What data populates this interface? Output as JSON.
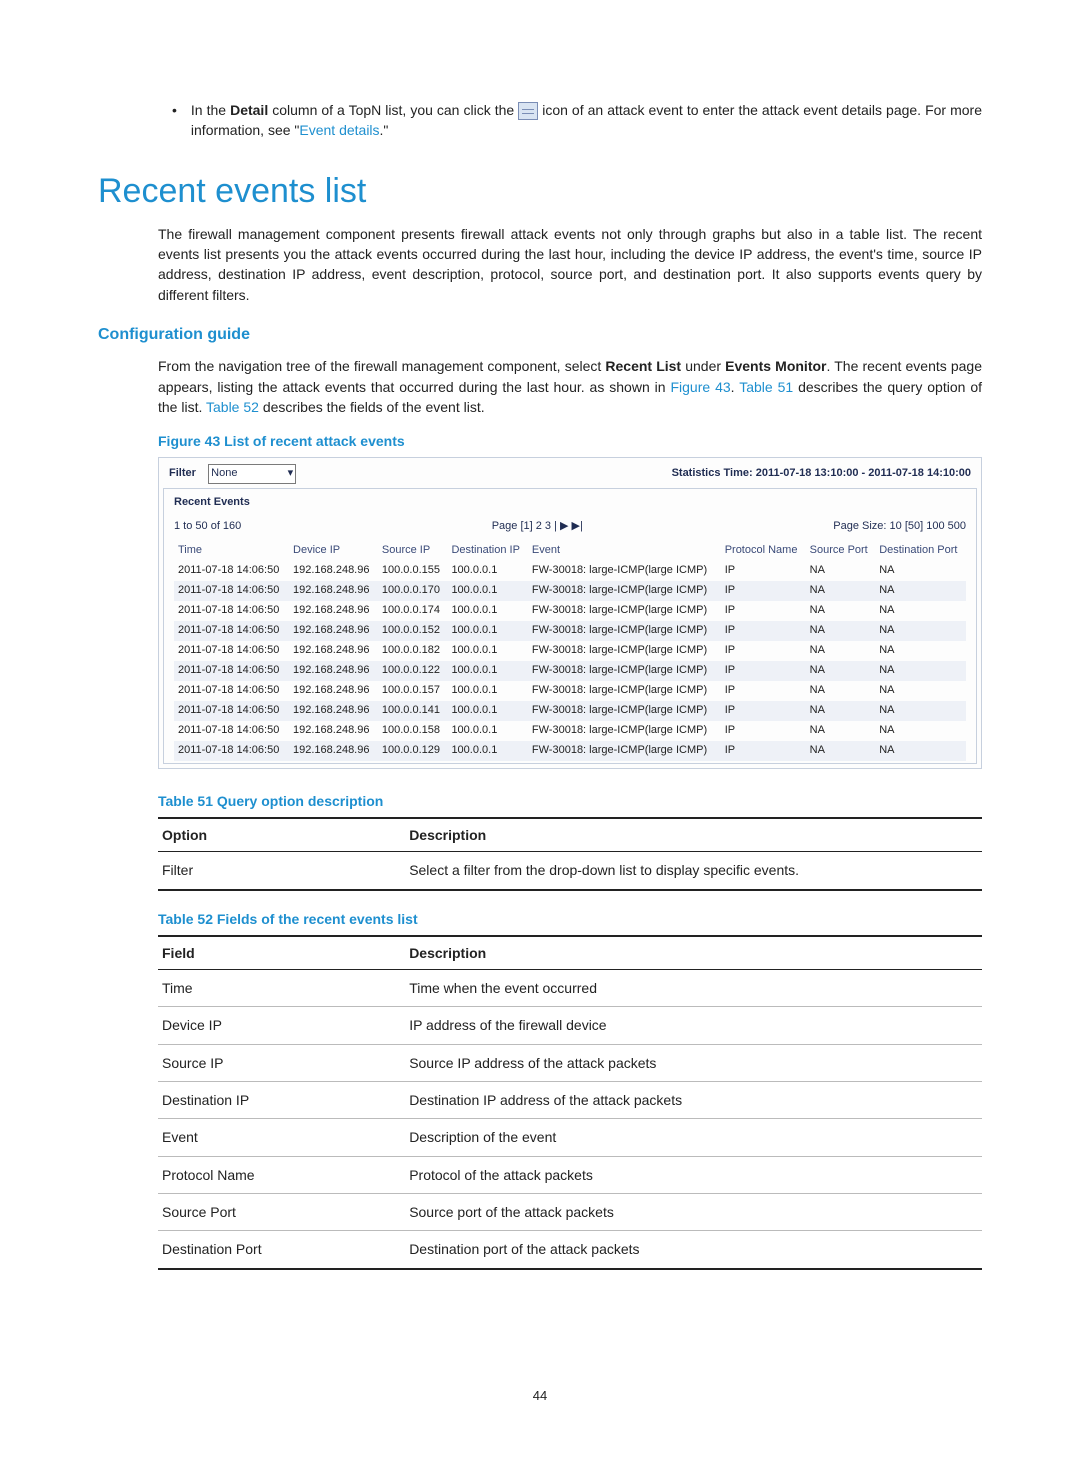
{
  "intro": {
    "bullet_pre": "In the ",
    "bullet_detail": "Detail",
    "bullet_mid": " column of a TopN list, you can click the ",
    "bullet_post1": " icon of an attack event to enter the attack event details page. For more information, see \"",
    "bullet_link": "Event details",
    "bullet_post2": ".\""
  },
  "heading": "Recent events list",
  "body_para": "The firewall management component presents firewall attack events not only through graphs but also in a table list. The recent events list presents you the attack events occurred during the last hour, including the device IP address, the event's time, source IP address, destination IP address, event description, protocol, source port, and destination port. It also supports events query by different filters.",
  "config_heading": "Configuration guide",
  "config_para_pre": "From the navigation tree of the firewall management component, select ",
  "config_bold1": "Recent List",
  "config_mid": " under ",
  "config_bold2": "Events Monitor",
  "config_post1": ". The recent events page appears, listing the attack events that occurred during the last hour. as shown in ",
  "config_link1": "Figure 43",
  "config_post2": ". ",
  "config_link2": "Table 51",
  "config_post3": " describes the query option of the list. ",
  "config_link3": "Table 52",
  "config_post4": " describes the fields of the event list.",
  "fig43_caption": "Figure 43 List of recent attack events",
  "shot": {
    "filter_label": "Filter",
    "filter_value": "None",
    "stats_time": "Statistics Time: 2011-07-18 13:10:00 - 2011-07-18 14:10:00",
    "recent_events": "Recent Events",
    "pager_left": "1 to 50 of 160",
    "pager_mid": "Page [1] 2 3 |  ▶  ▶|",
    "pager_right": "Page Size: 10 [50] 100 500",
    "cols": [
      "Time",
      "Device IP",
      "Source IP",
      "Destination IP",
      "Event",
      "Protocol Name",
      "Source Port",
      "Destination Port"
    ],
    "rows": [
      [
        "2011-07-18 14:06:50",
        "192.168.248.96",
        "100.0.0.155",
        "100.0.0.1",
        "FW-30018: large-ICMP(large ICMP)",
        "IP",
        "NA",
        "NA"
      ],
      [
        "2011-07-18 14:06:50",
        "192.168.248.96",
        "100.0.0.170",
        "100.0.0.1",
        "FW-30018: large-ICMP(large ICMP)",
        "IP",
        "NA",
        "NA"
      ],
      [
        "2011-07-18 14:06:50",
        "192.168.248.96",
        "100.0.0.174",
        "100.0.0.1",
        "FW-30018: large-ICMP(large ICMP)",
        "IP",
        "NA",
        "NA"
      ],
      [
        "2011-07-18 14:06:50",
        "192.168.248.96",
        "100.0.0.152",
        "100.0.0.1",
        "FW-30018: large-ICMP(large ICMP)",
        "IP",
        "NA",
        "NA"
      ],
      [
        "2011-07-18 14:06:50",
        "192.168.248.96",
        "100.0.0.182",
        "100.0.0.1",
        "FW-30018: large-ICMP(large ICMP)",
        "IP",
        "NA",
        "NA"
      ],
      [
        "2011-07-18 14:06:50",
        "192.168.248.96",
        "100.0.0.122",
        "100.0.0.1",
        "FW-30018: large-ICMP(large ICMP)",
        "IP",
        "NA",
        "NA"
      ],
      [
        "2011-07-18 14:06:50",
        "192.168.248.96",
        "100.0.0.157",
        "100.0.0.1",
        "FW-30018: large-ICMP(large ICMP)",
        "IP",
        "NA",
        "NA"
      ],
      [
        "2011-07-18 14:06:50",
        "192.168.248.96",
        "100.0.0.141",
        "100.0.0.1",
        "FW-30018: large-ICMP(large ICMP)",
        "IP",
        "NA",
        "NA"
      ],
      [
        "2011-07-18 14:06:50",
        "192.168.248.96",
        "100.0.0.158",
        "100.0.0.1",
        "FW-30018: large-ICMP(large ICMP)",
        "IP",
        "NA",
        "NA"
      ],
      [
        "2011-07-18 14:06:50",
        "192.168.248.96",
        "100.0.0.129",
        "100.0.0.1",
        "FW-30018: large-ICMP(large ICMP)",
        "IP",
        "NA",
        "NA"
      ]
    ]
  },
  "tbl51_caption": "Table 51 Query option description",
  "tbl51": {
    "h1": "Option",
    "h2": "Description",
    "rows": [
      [
        "Filter",
        "Select a filter from the drop-down list to display specific events."
      ]
    ]
  },
  "tbl52_caption": "Table 52 Fields of the recent events list",
  "tbl52": {
    "h1": "Field",
    "h2": "Description",
    "rows": [
      [
        "Time",
        "Time when the event occurred"
      ],
      [
        "Device IP",
        "IP address of the firewall device"
      ],
      [
        "Source IP",
        "Source IP address of the attack packets"
      ],
      [
        "Destination IP",
        "Destination IP address of the attack packets"
      ],
      [
        "Event",
        "Description of the event"
      ],
      [
        "Protocol Name",
        "Protocol of the attack packets"
      ],
      [
        "Source Port",
        "Source port of the attack packets"
      ],
      [
        "Destination Port",
        "Destination port of the attack packets"
      ]
    ]
  },
  "page_num": "44"
}
